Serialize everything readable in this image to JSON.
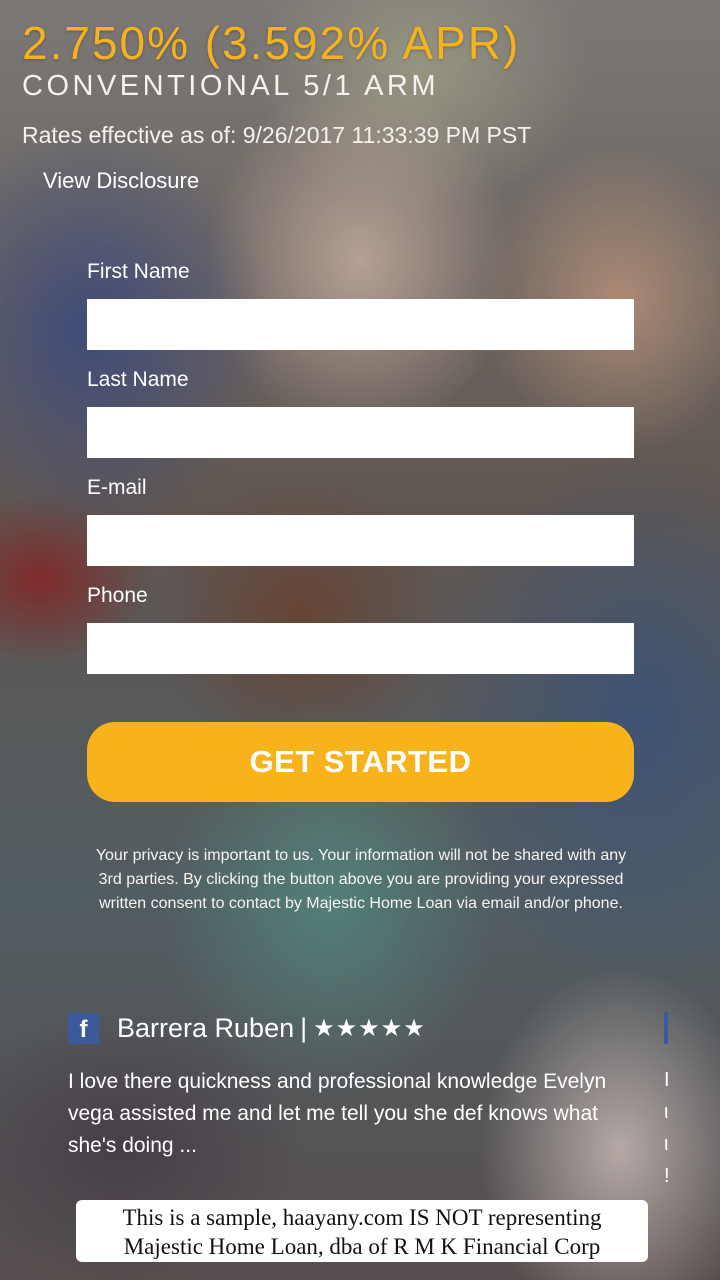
{
  "rate": {
    "headline": "2.750% (3.592% APR)",
    "product": "CONVENTIONAL 5/1 ARM",
    "effective": "Rates effective as of: 9/26/2017 11:33:39 PM PST",
    "disclosure_link": "View Disclosure"
  },
  "form": {
    "first_name_label": "First Name",
    "last_name_label": "Last Name",
    "email_label": "E-mail",
    "phone_label": "Phone",
    "first_name_value": "",
    "last_name_value": "",
    "email_value": "",
    "phone_value": "",
    "submit_label": "GET STARTED"
  },
  "privacy": "Your privacy is important to us. Your information will not be shared with any 3rd parties. By clicking the button above you are providing your expressed written consent to contact by Majestic Home Loan via email and/or phone.",
  "review": {
    "source_icon": "facebook-icon",
    "source_glyph": "f",
    "reviewer": "Barrera Ruben",
    "separator": "|",
    "stars": "★★★★★",
    "text": "I love there quickness and professional knowledge Evelyn vega assisted me and let me tell you she def knows what she's doing ..."
  },
  "disclaimer": {
    "line1": "This is a sample, haayany.com IS NOT representing",
    "line2": "Majestic Home Loan, dba of R M K Financial Corp"
  },
  "colors": {
    "accent": "#f5b21f",
    "button": "#f8b21b",
    "facebook": "#3b5a9a"
  }
}
